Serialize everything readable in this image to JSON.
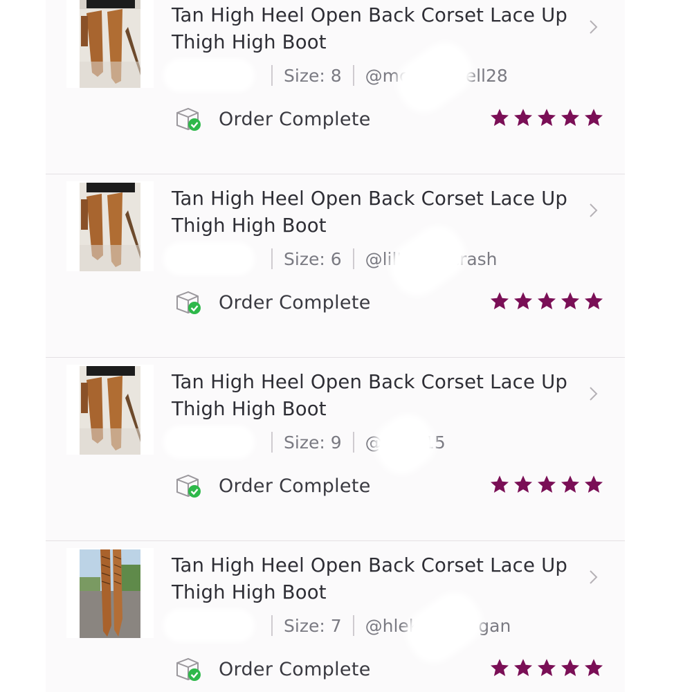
{
  "orders": [
    {
      "title": "Tan High Heel Open Back Corset Lace Up Thigh High Boot",
      "size": "Size: 8",
      "handle_start": "@mc",
      "handle_end": "ell28",
      "status": "Order Complete",
      "rating": 5,
      "thumbnail": "boots-on-legs-photo"
    },
    {
      "title": "Tan High Heel Open Back Corset Lace Up Thigh High Boot",
      "size": "Size: 6",
      "handle_start": "@lil'",
      "handle_end": "crash",
      "status": "Order Complete",
      "rating": 5,
      "thumbnail": "boots-on-legs-photo"
    },
    {
      "title": "Tan High Heel Open Back Corset Lace Up Thigh High Boot",
      "size": "Size: 9",
      "handle_start": "@e",
      "handle_end": "15",
      "status": "Order Complete",
      "rating": 5,
      "thumbnail": "boots-on-legs-photo"
    },
    {
      "title": "Tan High Heel Open Back Corset Lace Up Thigh High Boot",
      "size": "Size: 7",
      "handle_start": "@hlek",
      "handle_end": "gan",
      "status": "Order Complete",
      "rating": 5,
      "thumbnail": "boots-back-lace-photo"
    }
  ],
  "colors": {
    "star": "#7a0f56",
    "check_badge": "#2eb84a",
    "title_text": "#2e2e35",
    "meta_text": "#7a7a82",
    "divider": "#e4e0e3"
  },
  "icons": {
    "chevron": "chevron-right-icon",
    "status": "delivered-box-check-icon",
    "rating": "star-icon"
  }
}
